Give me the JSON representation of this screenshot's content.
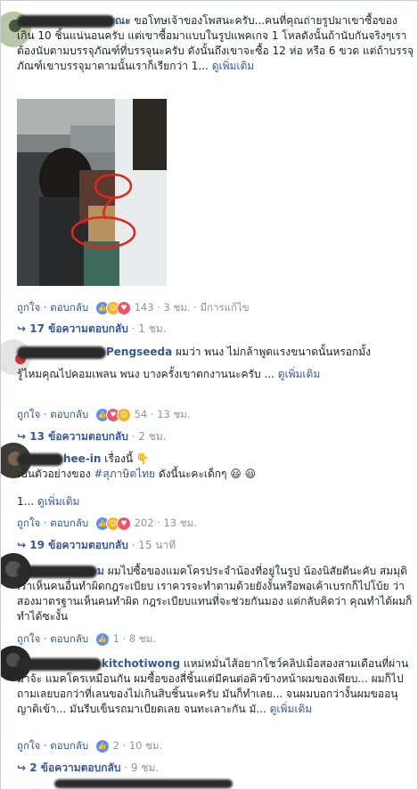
{
  "comments": [
    {
      "name_suffix": "ณะ",
      "text": "ขอโทษเจ้าของโพสนะครับ...คนที่คุณถ่ายรูปมาเขาซื้อของเกิน 10 ชิ้นแน่นอนครับ แต่เขาซื้อมาแบบในรูปแพคเกจ 1 โหลดังนั้นถ้านับกันจริงๆเราต้องนับตามบรรจุภัณฑ์ที่บรรจุนะครับ ดังนั้นถึงเขาจะซื้อ 12 ห่อ หรือ 6 ขวด แต่ถ้าบรรจุภัณฑ์เขาบรรจุมาตามนั้นเราก็เรียกว่า 1...",
      "see_more": "ดูเพิ่มเติม",
      "like": "ถูกใจ",
      "reply": "ตอบกลับ",
      "reaction_count": "143",
      "time": "3 ชม.",
      "edited": "มีการแก้ไข",
      "replies_label": "17 ข้อความตอบกลับ",
      "replies_time": "1 ชม."
    },
    {
      "name_suffix": "Pengseeda",
      "text_line1": "ผมว่า พนง ไม่กล้าพูดแรงขนาดนั้นหรอกมั้ง",
      "text_line2": "รู้ไหมคุณไปคอมเพลน พนง บางครั้งเขาตกงานนะครับ ...",
      "see_more": "ดูเพิ่มเติม",
      "like": "ถูกใจ",
      "reply": "ตอบกลับ",
      "reaction_count": "54",
      "time": "13 ชม.",
      "replies_label": "13 ข้อความตอบกลับ",
      "replies_time": "2 ชม."
    },
    {
      "name_suffix": "hee-in",
      "text_line1": "เรื่องนี้ 👇",
      "text_line2_prefix": "เป็นตัวอย่างของ ",
      "hashtag": "#สุภาษิตไทย",
      "text_line2_suffix": " ดังนี้นะคะเด็กๆ 😃 😃",
      "text_line3": "1...",
      "see_more": "ดูเพิ่มเติม",
      "like": "ถูกใจ",
      "reply": "ตอบกลับ",
      "reaction_count": "202",
      "time": "13 ชม.",
      "replies_label": "19 ข้อความตอบกลับ",
      "replies_time": "15 นาที"
    },
    {
      "name_suffix": "ม",
      "text": "ผมไปซื้อของแมคโครประจำน้องที่อยู่ในรูป น้องนิสัยดีนะคับ สมมุติเราเห็นคนอื่นทำผิดกฎระเบียบ เราควรจะทำตามด้วยยังงั้นหรือพอเค้าเบรกก็ไปโบ้ย ว่าสองมาตรฐานเห็นคนทำผิด กฎระเบียบแทนที่จะช่วยกันมอง แต่กลับคิดว่า คุณทำได้ผมก็ทำได้ซะงั้น",
      "like": "ถูกใจ",
      "reply": "ตอบกลับ",
      "reaction_count": "1",
      "time": "8 ชม."
    },
    {
      "name_suffix": "kitchotiwong",
      "text": "แหม่หมั่นไส้อยากโชว์คลิปเมื่อสองสามเดือนที่ผ่านมาจ้ะ แมคโครเหมือนกัน ผมซื้อของสี่ชิ้นแต่มีคนต่อคิวข้างหน้าผมของเพียบ... ผมก็ไปถามเลยบอกว่าที่เลนของไม่เกินสิบชิ้นนะครับ มันก็ทำเลย... จนผมบอกว่างั้นผมขออนุญาติเข้า... มันรีบเข็นรถมาเบียดเลย จนทะเลาะกัน มั...",
      "see_more": "ดูเพิ่มเติม",
      "like": "ถูกใจ",
      "reply": "ตอบกลับ",
      "reaction_count": "2",
      "time": "10 ชม.",
      "replies_label": "2 ข้อความตอบกลับ",
      "replies_time": "9 ชม."
    }
  ],
  "colors": {
    "link": "#365899",
    "meta": "#90949c",
    "annotation": "#e0261b"
  }
}
